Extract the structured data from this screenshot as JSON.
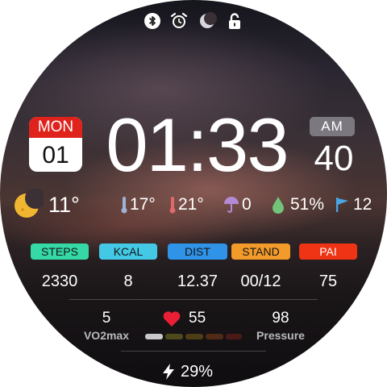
{
  "status_icons": [
    "bluetooth-icon",
    "alarm-icon",
    "do-not-disturb-icon",
    "lock-icon"
  ],
  "date": {
    "weekday": "MON",
    "day": "01"
  },
  "time": {
    "hhmm": "01:33",
    "ampm": "AM",
    "seconds": "40"
  },
  "weather": {
    "condition_icon": "moon-icon",
    "current_temp": "11°",
    "low_temp": "17°",
    "high_temp": "21°",
    "precipitation": "0",
    "humidity": "51%",
    "wind": "12"
  },
  "activity": [
    {
      "label": "STEPS",
      "value": "2330",
      "color": "#35d9a6"
    },
    {
      "label": "KCAL",
      "value": "8",
      "color": "#43c9e6"
    },
    {
      "label": "DIST",
      "value": "12.37",
      "color": "#2f93e8"
    },
    {
      "label": "STAND",
      "value": "00/12",
      "color": "#f39b2a"
    },
    {
      "label": "PAI",
      "value": "75",
      "color": "#ef3416"
    }
  ],
  "vo2max": {
    "value": "5",
    "label": "VO2max"
  },
  "heart_rate": {
    "value": "55",
    "zone_fraction": 0.2
  },
  "pressure": {
    "value": "98",
    "label": "Pressure"
  },
  "battery": {
    "value": "29%"
  }
}
